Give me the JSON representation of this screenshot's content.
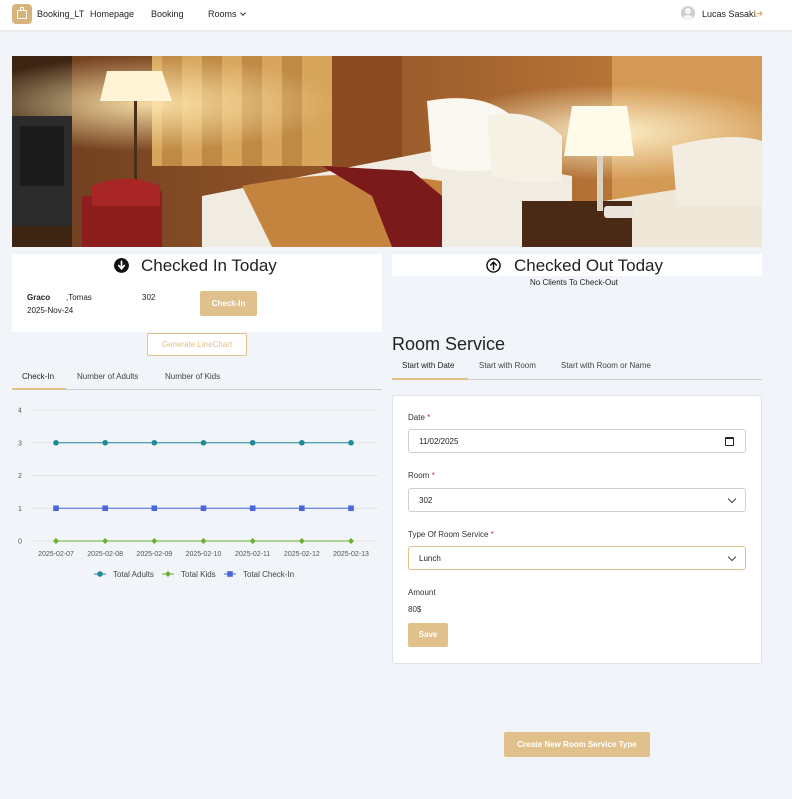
{
  "navbar": {
    "brand": "Booking_LT",
    "homepage": "Homepage",
    "booking": "Booking",
    "rooms": "Rooms",
    "user": "Lucas Sasaki"
  },
  "checked_in": {
    "title": "Checked In Today",
    "guest": {
      "last_name": "Graco",
      "first_name": ",Tomas",
      "room": "302",
      "date": "2025-Nov-24"
    },
    "checkin_button": "Check-In"
  },
  "checked_out": {
    "title": "Checked Out Today",
    "empty_message": "No Clients To Check-Out"
  },
  "chart_section": {
    "generate_button": "Generate LineChart",
    "tabs": [
      "Check-In",
      "Number of Adults",
      "Number of Kids"
    ],
    "active_tab": 0
  },
  "chart_data": {
    "type": "line",
    "x": [
      "2025-02-07",
      "2025-02-08",
      "2025-02-09",
      "2025-02-10",
      "2025-02-11",
      "2025-02-12",
      "2025-02-13"
    ],
    "yticks": [
      0,
      1,
      2,
      3,
      4
    ],
    "ylim": [
      0,
      4
    ],
    "grid": true,
    "legend_position": "bottom",
    "series": [
      {
        "name": "Total Adults",
        "values": [
          3,
          3,
          3,
          3,
          3,
          3,
          3
        ],
        "color": "#1e8a96",
        "marker": "circle"
      },
      {
        "name": "Total Kids",
        "values": [
          0,
          0,
          0,
          0,
          0,
          0,
          0
        ],
        "color": "#6ab22e",
        "marker": "diamond"
      },
      {
        "name": "Total Check-In",
        "values": [
          1,
          1,
          1,
          1,
          1,
          1,
          1
        ],
        "color": "#4a66d9",
        "marker": "square"
      }
    ]
  },
  "room_service": {
    "title": "Room Service",
    "tabs": [
      "Start with Date",
      "Start with Room",
      "Start with Room or Name"
    ],
    "active_tab": 0,
    "date_label": "Date",
    "date_value": "11/02/2025",
    "room_label": "Room",
    "room_value": "302",
    "type_label": "Type Of Room Service",
    "type_value": "Lunch",
    "amount_label": "Amount",
    "amount_value": "80$",
    "required_mark": "*",
    "save_button": "Save",
    "create_button": "Create New Room Service Type"
  },
  "colors": {
    "accent": "#e0c18b",
    "page_bg": "#f1f4f8"
  }
}
